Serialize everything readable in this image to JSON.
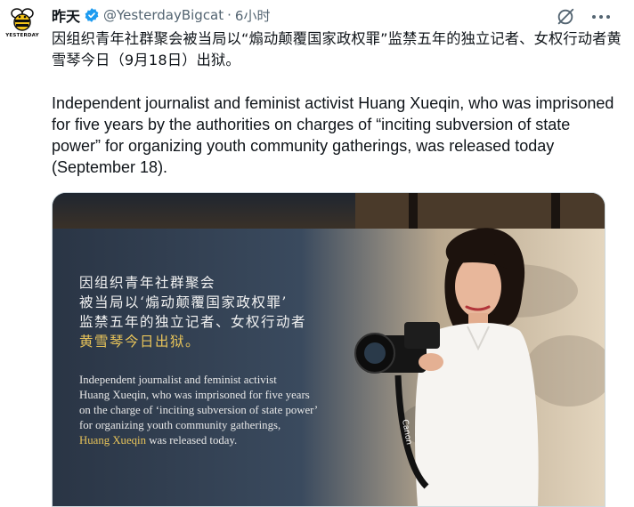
{
  "author": {
    "display_name": "昨天",
    "handle": "@YesterdayBigcat",
    "separator": "·",
    "time": "6小时",
    "avatar_label": "YESTERDAY",
    "verified": true,
    "verified_color": "#1d9bf0"
  },
  "actions": {
    "grok_icon": "grok-slash-icon",
    "more_icon": "more-horizontal-icon"
  },
  "tweet": {
    "text_zh": "因组织青年社群聚会被当局以“煽动颠覆国家政权罪”监禁五年的独立记者、女权行动者黄雪琴今日（9月18日）出狱。",
    "text_en": "Independent journalist and feminist activist Huang Xueqin, who was imprisoned for five years by the authorities on charges of “inciting subversion of state power” for organizing youth community gatherings, was released today (September 18)."
  },
  "media": {
    "overlay_zh_lines": [
      "因组织青年社群聚会",
      "被当局以‘煽动颠覆国家政权罪’",
      "监禁五年的独立记者、女权行动者"
    ],
    "overlay_zh_gold": "黄雪琴今日出狱。",
    "overlay_en_lines": [
      "Independent journalist and feminist activist",
      "Huang Xueqin, who was imprisoned for five years",
      "on the charge of ‘inciting subversion of state power’",
      "for organizing youth community gatherings,"
    ],
    "overlay_en_gold": "Huang Xueqin",
    "overlay_en_tail": " was released today.",
    "camera_brand": "Canon",
    "accent_gold": "#e8c45a"
  }
}
